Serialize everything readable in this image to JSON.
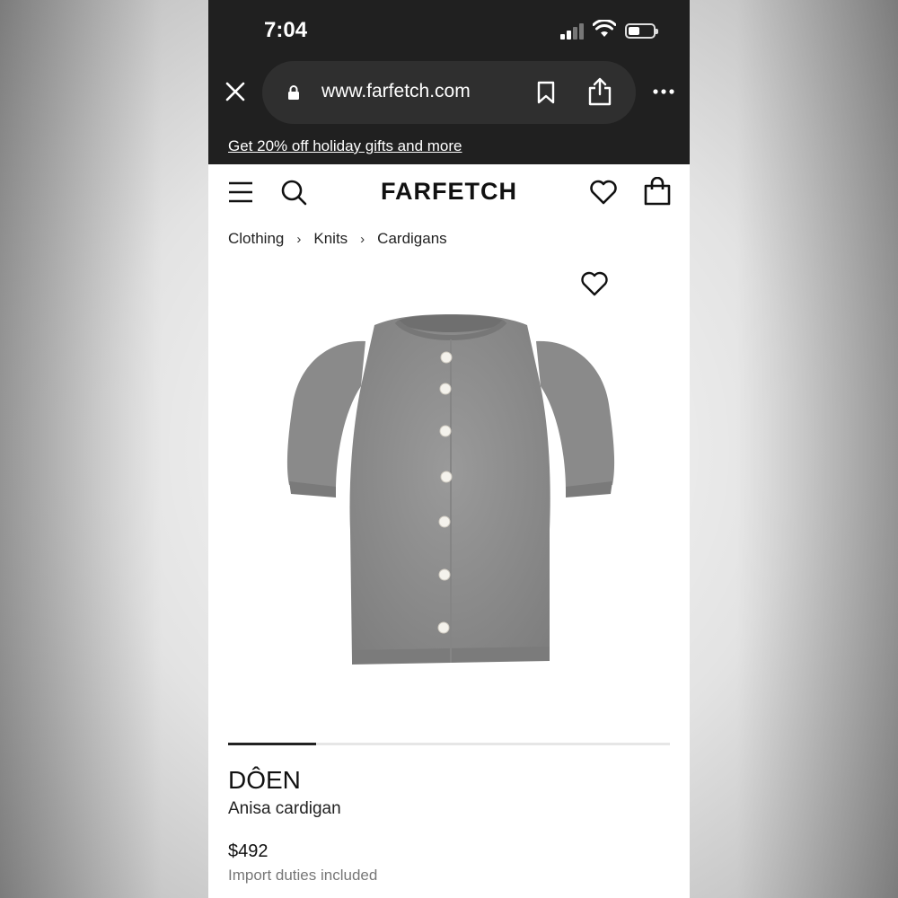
{
  "status_bar": {
    "time": "7:04"
  },
  "browser": {
    "url": "www.farfetch.com"
  },
  "promo": {
    "text": "Get 20% off holiday gifts and more"
  },
  "header": {
    "logo": "FARFETCH"
  },
  "breadcrumb": {
    "items": [
      "Clothing",
      "Knits",
      "Cardigans"
    ],
    "separator": "›"
  },
  "gallery": {
    "progress_fraction": 0.2
  },
  "product": {
    "brand": "DÔEN",
    "name": "Anisa cardigan",
    "price": "$492",
    "duties_note": "Import duties included"
  },
  "icons": [
    "close-icon",
    "lock-icon",
    "bookmark-icon",
    "share-icon",
    "more-icon",
    "menu-icon",
    "search-icon",
    "heart-icon",
    "bag-icon"
  ],
  "colors": {
    "chrome": "#202020",
    "url_pill": "#2f2f2f",
    "text_primary": "#111111",
    "text_muted": "#777777",
    "sweater_gray": "#8c8c8c"
  }
}
